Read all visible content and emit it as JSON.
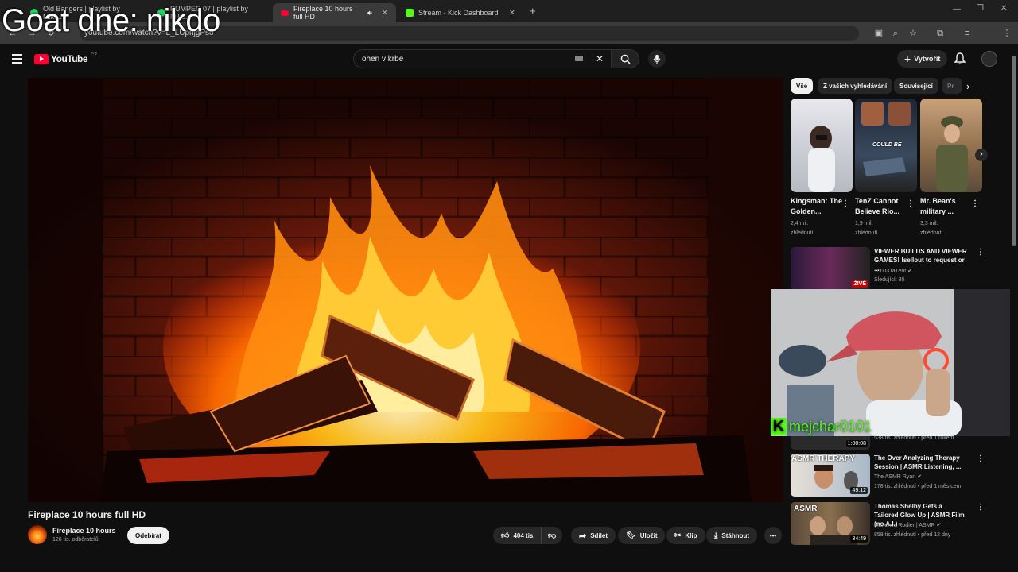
{
  "overlay_text": "Goat dne: nikdo",
  "browser": {
    "tabs": [
      {
        "label": "Old Bangers | playlist by Mike...",
        "color": "#1ed760"
      },
      {
        "label": "PUMPEC 07 | playlist by Mike...",
        "color": "#1ed760"
      },
      {
        "label": "Fireplace 10 hours full HD",
        "color": "#ff0033"
      },
      {
        "label": "Stream - Kick Dashboard",
        "color": "#53fc18"
      }
    ],
    "url": "youtube.com/watch?v=L_LUpnjgPso"
  },
  "youtube": {
    "logo_text": "YouTube",
    "country": "CZ",
    "search_query": "ohen v krbe",
    "create_label": "Vytvořit"
  },
  "video": {
    "title": "Fireplace 10 hours full HD",
    "channel": "Fireplace 10 hours",
    "subscribers": "126 tis. odběratelů",
    "subscribe_label": "Odebírat",
    "likes": "404 tis.",
    "share_label": "Sdílet",
    "save_label": "Uložit",
    "clip_label": "Klip",
    "download_label": "Stáhnout"
  },
  "chips": [
    "Vše",
    "Z vašich vyhledávání",
    "Související",
    "Pr"
  ],
  "shorts": [
    {
      "title": "Kingsman: The Golden...",
      "views": "2,4 mil.",
      "views_label": "zhlédnutí"
    },
    {
      "title": "TenZ Cannot Believe Rio...",
      "views": "1,9 mil.",
      "views_label": "zhlédnutí",
      "caption": "COULD BE"
    },
    {
      "title": "Mr. Bean's military ...",
      "views": "3,3 mil.",
      "views_label": "zhlédnutí"
    }
  ],
  "recommendations": [
    {
      "title": "VIEWER BUILDS AND VIEWER GAMES! !sellout to request or ...",
      "channel": "Tr1U3Ta1ent",
      "meta": "Sledující: 85",
      "badge": "ŽIVĚ"
    },
    {
      "title": "",
      "channel": "",
      "meta": "538 tis. zhlédnutí • před 1 rokem",
      "duration": "1:00:08"
    },
    {
      "title": "The Over Analyzing Therapy Session | ASMR Listening, ...",
      "channel": "The ASMR Ryan",
      "meta": "178 tis. zhlédnutí • před 1 měsícem",
      "duration": "49:12",
      "thumb_text": "ASMR THERAPY"
    },
    {
      "title": "Thomas Shelby Gets a Tailored Glow Up | ASMR Film (no A.I.)",
      "channel": "Maxence Rodier | ASMR",
      "meta": "858 tis. zhlédnutí • před 12 dny",
      "duration": "34:49",
      "thumb_text": "ASMR"
    }
  ],
  "stream_overlay": {
    "username": "mejchar0101"
  }
}
